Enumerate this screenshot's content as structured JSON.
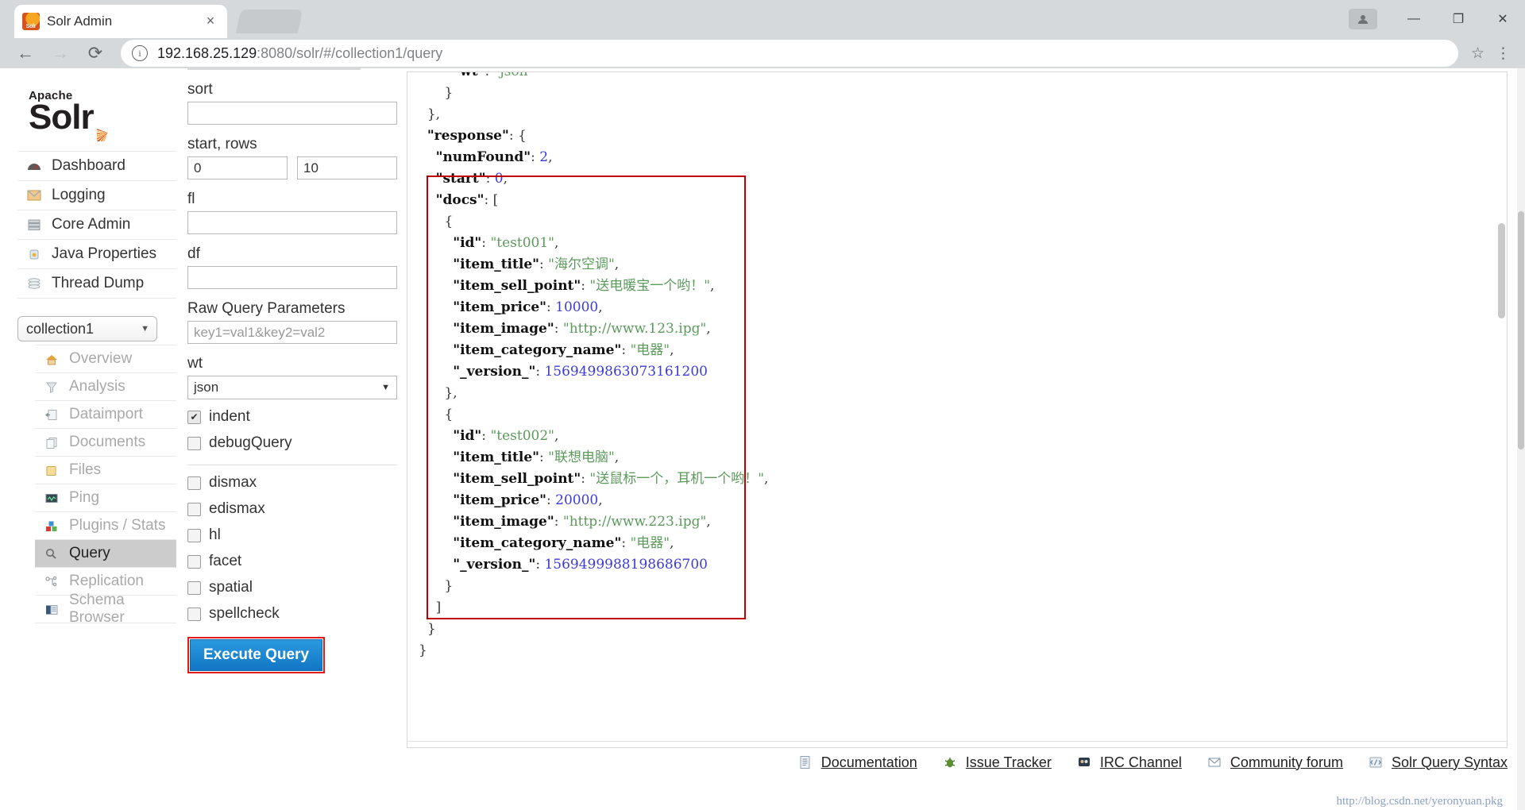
{
  "browser": {
    "tab": {
      "title": "Solr Admin",
      "favicon": "solr-favicon",
      "close": "×"
    },
    "nav": {
      "back": "←",
      "forward": "→",
      "reload": "⟳"
    },
    "address": {
      "info": "i",
      "host": "192.168.25.129",
      "rest": ":8080/solr/#/collection1/query",
      "star": "☆",
      "menu": "⋮"
    },
    "window": {
      "profile": "■",
      "minimize": "—",
      "maximize": "❐",
      "close": "✕"
    }
  },
  "sidebar": {
    "logo": {
      "apache": "Apache",
      "solr": "Solr"
    },
    "main_items": [
      {
        "label": "Dashboard",
        "icon": "dashboard-icon",
        "glyph": "◔"
      },
      {
        "label": "Logging",
        "icon": "logging-icon",
        "glyph": "✉"
      },
      {
        "label": "Core Admin",
        "icon": "core-admin-icon",
        "glyph": "☷"
      },
      {
        "label": "Java Properties",
        "icon": "java-properties-icon",
        "glyph": "⚱"
      },
      {
        "label": "Thread Dump",
        "icon": "thread-dump-icon",
        "glyph": "≡"
      }
    ],
    "core_selector": {
      "value": "collection1",
      "caret": "▼"
    },
    "core_items": [
      {
        "label": "Overview",
        "icon": "home-icon",
        "glyph": "⌂",
        "active": false
      },
      {
        "label": "Analysis",
        "icon": "funnel-icon",
        "glyph": "▽",
        "active": false
      },
      {
        "label": "Dataimport",
        "icon": "dataimport-icon",
        "glyph": "☰",
        "active": false
      },
      {
        "label": "Documents",
        "icon": "documents-icon",
        "glyph": "❐",
        "active": false
      },
      {
        "label": "Files",
        "icon": "folder-icon",
        "glyph": "▰",
        "active": false
      },
      {
        "label": "Ping",
        "icon": "ping-icon",
        "glyph": "⌨",
        "active": false
      },
      {
        "label": "Plugins / Stats",
        "icon": "plugins-icon",
        "glyph": "❖",
        "active": false
      },
      {
        "label": "Query",
        "icon": "search-icon",
        "glyph": "⚲",
        "active": true
      },
      {
        "label": "Replication",
        "icon": "replication-icon",
        "glyph": "⑂",
        "active": false
      },
      {
        "label": "Schema Browser",
        "icon": "schema-browser-icon",
        "glyph": "⌼",
        "active": false
      }
    ]
  },
  "query_form": {
    "sort": {
      "label": "sort",
      "value": ""
    },
    "start_rows": {
      "label": "start, rows",
      "start": "0",
      "rows": "10"
    },
    "fl": {
      "label": "fl",
      "value": ""
    },
    "df": {
      "label": "df",
      "value": ""
    },
    "raw_query_parameters": {
      "label": "Raw Query Parameters",
      "placeholder": "key1=val1&key2=val2"
    },
    "wt": {
      "label": "wt",
      "value": "json",
      "caret": "▼"
    },
    "checkboxes_top": [
      {
        "label": "indent",
        "checked": true,
        "mark": "✔"
      },
      {
        "label": "debugQuery",
        "checked": false,
        "mark": ""
      }
    ],
    "checkboxes_bottom": [
      {
        "label": "dismax",
        "checked": false,
        "mark": ""
      },
      {
        "label": "edismax",
        "checked": false,
        "mark": ""
      },
      {
        "label": "hl",
        "checked": false,
        "mark": ""
      },
      {
        "label": "facet",
        "checked": false,
        "mark": ""
      },
      {
        "label": "spatial",
        "checked": false,
        "mark": ""
      },
      {
        "label": "spellcheck",
        "checked": false,
        "mark": ""
      }
    ],
    "execute_button": "Execute Query"
  },
  "response": {
    "lines": [
      {
        "indent": 4,
        "parts": [
          {
            "t": "k",
            "v": "\"wt\""
          },
          {
            "t": "p",
            "v": ": "
          },
          {
            "t": "s",
            "v": "\"json\""
          }
        ]
      },
      {
        "indent": 3,
        "parts": [
          {
            "t": "p",
            "v": "}"
          }
        ]
      },
      {
        "indent": 1,
        "parts": [
          {
            "t": "p",
            "v": "},"
          }
        ]
      },
      {
        "indent": 1,
        "parts": [
          {
            "t": "k",
            "v": "\"response\""
          },
          {
            "t": "p",
            "v": ": {"
          }
        ]
      },
      {
        "indent": 2,
        "parts": [
          {
            "t": "k",
            "v": "\"numFound\""
          },
          {
            "t": "p",
            "v": ": "
          },
          {
            "t": "n",
            "v": "2"
          },
          {
            "t": "p",
            "v": ","
          }
        ]
      },
      {
        "indent": 2,
        "parts": [
          {
            "t": "k",
            "v": "\"start\""
          },
          {
            "t": "p",
            "v": ": "
          },
          {
            "t": "n",
            "v": "0"
          },
          {
            "t": "p",
            "v": ","
          }
        ]
      },
      {
        "indent": 2,
        "parts": [
          {
            "t": "k",
            "v": "\"docs\""
          },
          {
            "t": "p",
            "v": ": ["
          }
        ]
      },
      {
        "indent": 3,
        "parts": [
          {
            "t": "p",
            "v": "{"
          }
        ]
      },
      {
        "indent": 4,
        "parts": [
          {
            "t": "k",
            "v": "\"id\""
          },
          {
            "t": "p",
            "v": ": "
          },
          {
            "t": "s",
            "v": "\"test001\""
          },
          {
            "t": "p",
            "v": ","
          }
        ]
      },
      {
        "indent": 4,
        "parts": [
          {
            "t": "k",
            "v": "\"item_title\""
          },
          {
            "t": "p",
            "v": ": "
          },
          {
            "t": "s",
            "v": "\"海尔空调\""
          },
          {
            "t": "p",
            "v": ","
          }
        ]
      },
      {
        "indent": 4,
        "parts": [
          {
            "t": "k",
            "v": "\"item_sell_point\""
          },
          {
            "t": "p",
            "v": ": "
          },
          {
            "t": "s",
            "v": "\"送电暖宝一个哟！\""
          },
          {
            "t": "p",
            "v": ","
          }
        ]
      },
      {
        "indent": 4,
        "parts": [
          {
            "t": "k",
            "v": "\"item_price\""
          },
          {
            "t": "p",
            "v": ": "
          },
          {
            "t": "n",
            "v": "10000"
          },
          {
            "t": "p",
            "v": ","
          }
        ]
      },
      {
        "indent": 4,
        "parts": [
          {
            "t": "k",
            "v": "\"item_image\""
          },
          {
            "t": "p",
            "v": ": "
          },
          {
            "t": "s",
            "v": "\"http://www.123.ipg\""
          },
          {
            "t": "p",
            "v": ","
          }
        ]
      },
      {
        "indent": 4,
        "parts": [
          {
            "t": "k",
            "v": "\"item_category_name\""
          },
          {
            "t": "p",
            "v": ": "
          },
          {
            "t": "s",
            "v": "\"电器\""
          },
          {
            "t": "p",
            "v": ","
          }
        ]
      },
      {
        "indent": 4,
        "parts": [
          {
            "t": "k",
            "v": "\"_version_\""
          },
          {
            "t": "p",
            "v": ": "
          },
          {
            "t": "n",
            "v": "1569499863073161200"
          }
        ]
      },
      {
        "indent": 3,
        "parts": [
          {
            "t": "p",
            "v": "},"
          }
        ]
      },
      {
        "indent": 3,
        "parts": [
          {
            "t": "p",
            "v": "{"
          }
        ]
      },
      {
        "indent": 4,
        "parts": [
          {
            "t": "k",
            "v": "\"id\""
          },
          {
            "t": "p",
            "v": ": "
          },
          {
            "t": "s",
            "v": "\"test002\""
          },
          {
            "t": "p",
            "v": ","
          }
        ]
      },
      {
        "indent": 4,
        "parts": [
          {
            "t": "k",
            "v": "\"item_title\""
          },
          {
            "t": "p",
            "v": ": "
          },
          {
            "t": "s",
            "v": "\"联想电脑\""
          },
          {
            "t": "p",
            "v": ","
          }
        ]
      },
      {
        "indent": 4,
        "parts": [
          {
            "t": "k",
            "v": "\"item_sell_point\""
          },
          {
            "t": "p",
            "v": ": "
          },
          {
            "t": "s",
            "v": "\"送鼠标一个，耳机一个哟！\""
          },
          {
            "t": "p",
            "v": ","
          }
        ]
      },
      {
        "indent": 4,
        "parts": [
          {
            "t": "k",
            "v": "\"item_price\""
          },
          {
            "t": "p",
            "v": ": "
          },
          {
            "t": "n",
            "v": "20000"
          },
          {
            "t": "p",
            "v": ","
          }
        ]
      },
      {
        "indent": 4,
        "parts": [
          {
            "t": "k",
            "v": "\"item_image\""
          },
          {
            "t": "p",
            "v": ": "
          },
          {
            "t": "s",
            "v": "\"http://www.223.ipg\""
          },
          {
            "t": "p",
            "v": ","
          }
        ]
      },
      {
        "indent": 4,
        "parts": [
          {
            "t": "k",
            "v": "\"item_category_name\""
          },
          {
            "t": "p",
            "v": ": "
          },
          {
            "t": "s",
            "v": "\"电器\""
          },
          {
            "t": "p",
            "v": ","
          }
        ]
      },
      {
        "indent": 4,
        "parts": [
          {
            "t": "k",
            "v": "\"_version_\""
          },
          {
            "t": "p",
            "v": ": "
          },
          {
            "t": "n",
            "v": "1569499988198686700"
          }
        ]
      },
      {
        "indent": 3,
        "parts": [
          {
            "t": "p",
            "v": "}"
          }
        ]
      },
      {
        "indent": 2,
        "parts": [
          {
            "t": "p",
            "v": "]"
          }
        ]
      },
      {
        "indent": 1,
        "parts": [
          {
            "t": "p",
            "v": "}"
          }
        ]
      },
      {
        "indent": 0,
        "parts": [
          {
            "t": "p",
            "v": "}"
          }
        ]
      }
    ]
  },
  "footer": {
    "links": [
      {
        "label": "Documentation",
        "icon": "document-icon",
        "glyph": "▤"
      },
      {
        "label": "Issue Tracker",
        "icon": "bug-icon",
        "glyph": "✦"
      },
      {
        "label": "IRC Channel",
        "icon": "irc-icon",
        "glyph": "⚇"
      },
      {
        "label": "Community forum",
        "icon": "mail-icon",
        "glyph": "✉"
      },
      {
        "label": "Solr Query Syntax",
        "icon": "syntax-icon",
        "glyph": "⌗"
      }
    ],
    "watermark": "http://blog.csdn.net/yeronyuan.pkg"
  },
  "colors": {
    "accent_blue": "#1276c4",
    "highlight_red": "#c00000",
    "json_string": "#5c9a5c",
    "json_number": "#3b3bd8",
    "active_nav_bg": "#cccccc"
  }
}
